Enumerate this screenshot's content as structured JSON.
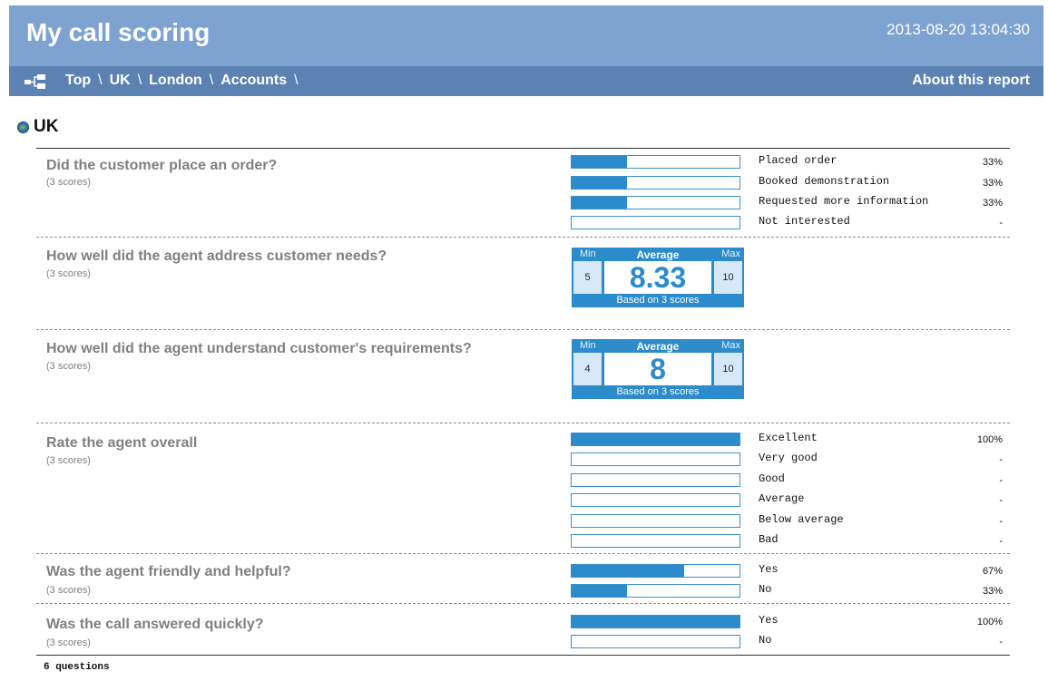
{
  "header": {
    "title": "My call scoring",
    "datetime": "2013-08-20 13:04:30"
  },
  "nav": {
    "crumbs": [
      "Top",
      "UK",
      "London",
      "Accounts"
    ],
    "separator": "\\",
    "about": "About this report"
  },
  "section": {
    "title": "UK"
  },
  "questions": [
    {
      "text": "Did the customer place an order?",
      "scores": "(3 scores)",
      "options": [
        {
          "label": "Placed order",
          "pct": "33%",
          "fraction": 0.33
        },
        {
          "label": "Booked demonstration",
          "pct": "33%",
          "fraction": 0.33
        },
        {
          "label": "Requested more information",
          "pct": "33%",
          "fraction": 0.33
        },
        {
          "label": "Not interested",
          "pct": "-",
          "fraction": 0
        }
      ]
    },
    {
      "text": "How well did the agent address customer needs?",
      "scores": "(3 scores)",
      "summary": {
        "min_label": "Min",
        "avg_label": "Average",
        "max_label": "Max",
        "min": "5",
        "avg": "8.33",
        "max": "10",
        "footer": "Based on 3 scores"
      }
    },
    {
      "text": "How well did the agent understand customer's requirements?",
      "scores": "(3 scores)",
      "summary": {
        "min_label": "Min",
        "avg_label": "Average",
        "max_label": "Max",
        "min": "4",
        "avg": "8",
        "max": "10",
        "footer": "Based on 3 scores"
      }
    },
    {
      "text": "Rate the agent overall",
      "scores": "(3 scores)",
      "options": [
        {
          "label": "Excellent",
          "pct": "100%",
          "fraction": 1
        },
        {
          "label": "Very good",
          "pct": "-",
          "fraction": 0
        },
        {
          "label": "Good",
          "pct": "-",
          "fraction": 0
        },
        {
          "label": "Average",
          "pct": "-",
          "fraction": 0
        },
        {
          "label": "Below average",
          "pct": "-",
          "fraction": 0
        },
        {
          "label": "Bad",
          "pct": "-",
          "fraction": 0
        }
      ]
    },
    {
      "text": "Was the agent friendly and helpful?",
      "scores": "(3 scores)",
      "options": [
        {
          "label": "Yes",
          "pct": "67%",
          "fraction": 0.67
        },
        {
          "label": "No",
          "pct": "33%",
          "fraction": 0.33
        }
      ]
    },
    {
      "text": "Was the call answered quickly?",
      "scores": "(3 scores)",
      "options": [
        {
          "label": "Yes",
          "pct": "100%",
          "fraction": 1
        },
        {
          "label": "No",
          "pct": "-",
          "fraction": 0
        }
      ]
    }
  ],
  "footer": {
    "count": "6 questions"
  },
  "colors": {
    "header_bg": "#7ea3d0",
    "nav_bg": "#5c82b4",
    "bar_fill": "#2b8bcb",
    "summary_cell": "#d6e8f7"
  }
}
